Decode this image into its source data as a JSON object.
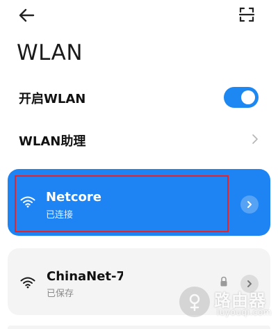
{
  "header": {
    "back_icon": "arrow-left-icon",
    "scan_icon": "scan-qr-icon",
    "title": "WLAN"
  },
  "settings": {
    "wlan_toggle_label": "开启WLAN",
    "wlan_enabled": true,
    "assistant_label": "WLAN助理"
  },
  "networks": [
    {
      "name": "Netcore",
      "status": "已连接",
      "connected": true,
      "icon": "wifi-icon"
    },
    {
      "name": "ChinaNet-7",
      "status": "已保存",
      "connected": false,
      "secured": true,
      "icon": "wifi-icon"
    }
  ],
  "watermark": {
    "cn": "路由器",
    "en": "luyouqi.com"
  },
  "colors": {
    "accent": "#1e84f3",
    "highlight_border": "#e3242b",
    "card_bg": "#f4f4f4"
  }
}
